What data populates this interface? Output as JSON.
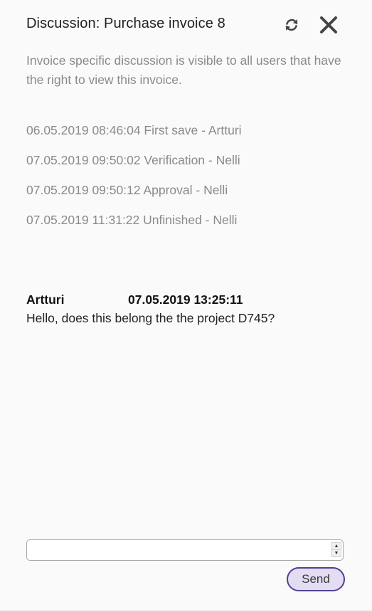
{
  "header": {
    "title": "Discussion: Purchase invoice 8",
    "refresh_icon": "refresh-icon",
    "close_icon": "close-icon"
  },
  "info_text": "Invoice specific discussion is visible to all users that have the right to view this invoice.",
  "log": [
    "06.05.2019 08:46:04 First save - Artturi",
    "07.05.2019 09:50:02 Verification - Nelli",
    "07.05.2019 09:50:12 Approval - Nelli",
    "07.05.2019 11:31:22 Unfinished - Nelli"
  ],
  "messages": [
    {
      "author": "Artturi",
      "timestamp": "07.05.2019 13:25:11",
      "text": "Hello, does this belong the the project D745?"
    }
  ],
  "composer": {
    "value": "",
    "placeholder": "",
    "send_label": "Send"
  },
  "colors": {
    "send_border": "#4e4290",
    "send_background": "#e4dcf2",
    "muted_text": "#8a8a8a"
  }
}
